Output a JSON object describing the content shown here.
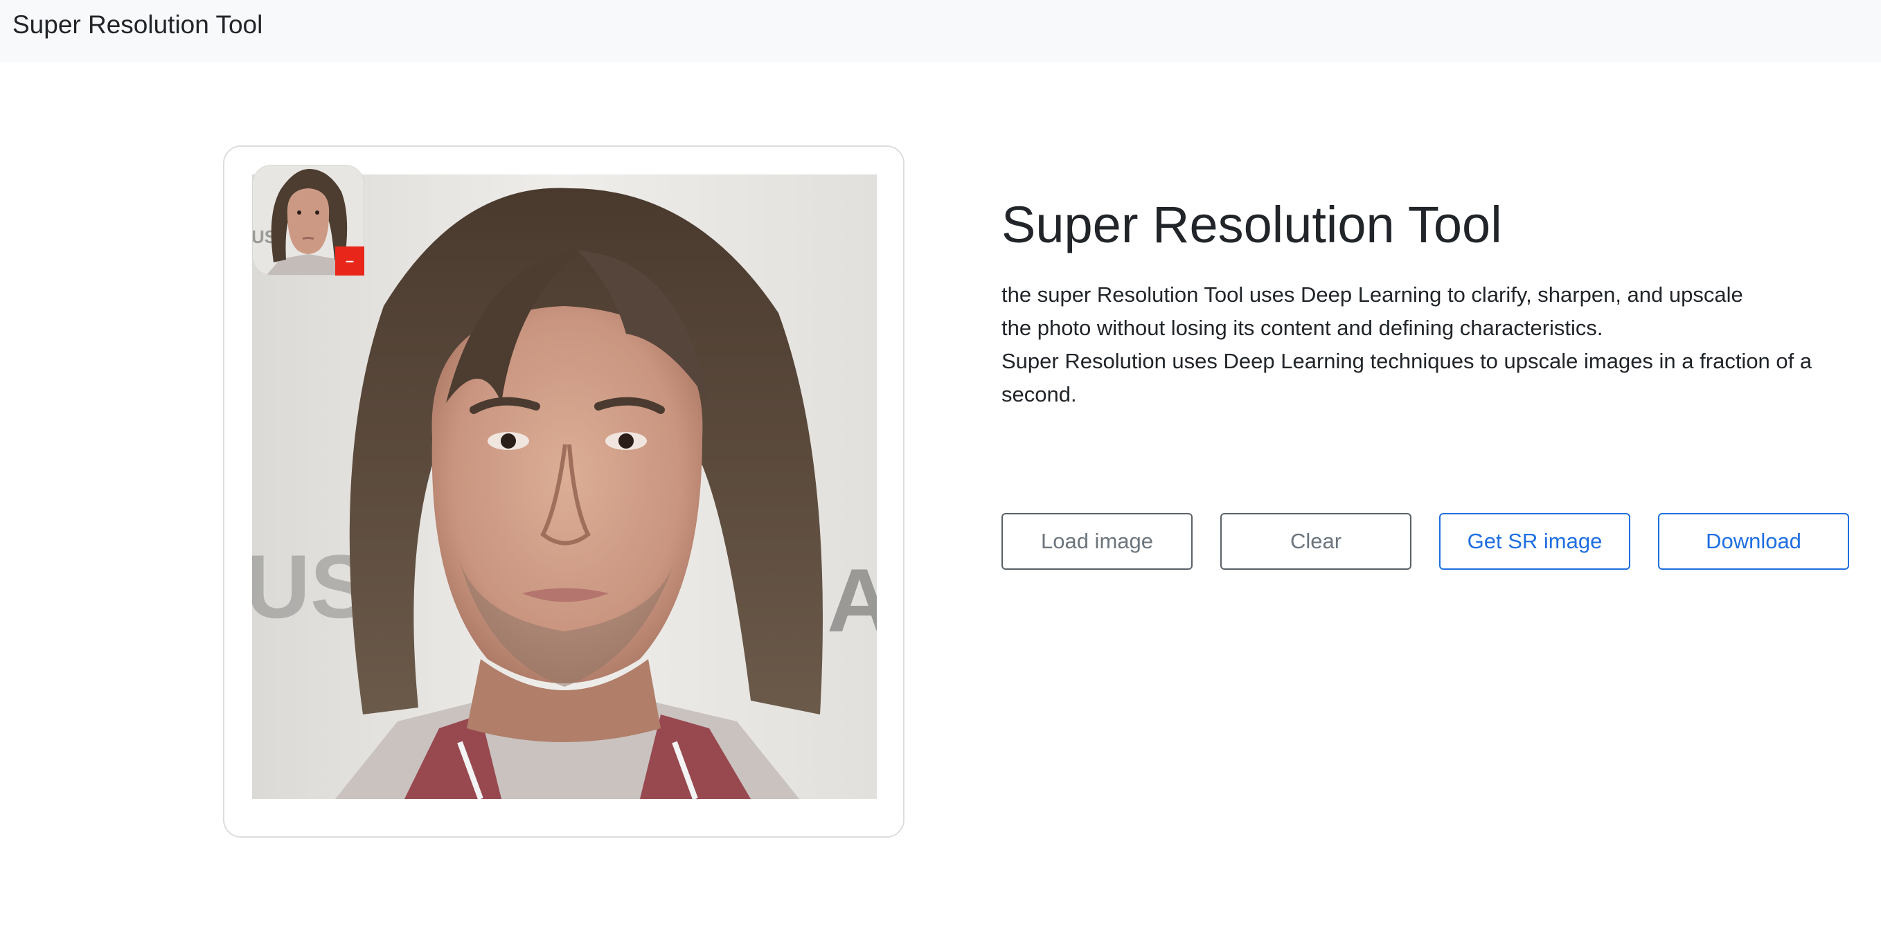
{
  "navbar": {
    "brand": "Super Resolution Tool"
  },
  "image_panel": {
    "thumbnail_remove_label": "–"
  },
  "info": {
    "title": "Super Resolution Tool",
    "description_lines": [
      "the super Resolution Tool uses Deep Learning to clarify, sharpen, and upscale",
      "the photo without losing its content and defining characteristics.",
      "Super Resolution uses Deep Learning techniques to upscale images in a fraction of a",
      "second."
    ]
  },
  "buttons": {
    "load": "Load image",
    "clear": "Clear",
    "get_sr": "Get SR image",
    "download": "Download"
  },
  "colors": {
    "navbar_bg": "#f8f9fa",
    "primary": "#1f6fe0",
    "secondary": "#6c757d",
    "danger": "#e8261a"
  }
}
